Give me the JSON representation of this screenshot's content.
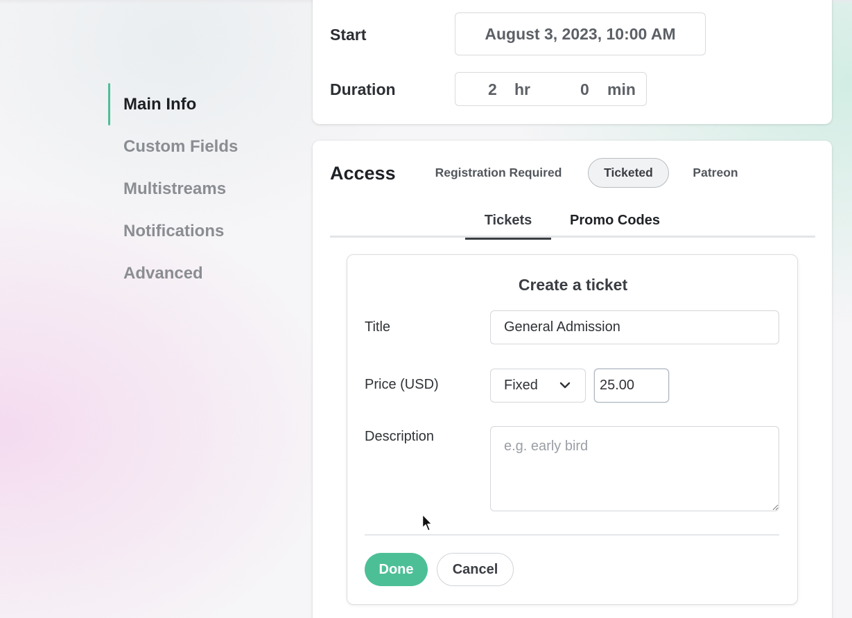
{
  "sidebar": {
    "items": [
      {
        "label": "Main Info",
        "active": true
      },
      {
        "label": "Custom Fields"
      },
      {
        "label": "Multistreams"
      },
      {
        "label": "Notifications"
      },
      {
        "label": "Advanced"
      }
    ]
  },
  "schedule": {
    "start_label": "Start",
    "start_value": "August 3, 2023, 10:00 AM",
    "duration_label": "Duration",
    "duration_hours": "2",
    "hours_unit": "hr",
    "duration_minutes": "0",
    "minutes_unit": "min"
  },
  "access": {
    "title": "Access",
    "options": [
      "Registration Required",
      "Ticketed",
      "Patreon"
    ],
    "selected_option": "Ticketed",
    "tabs": [
      "Tickets",
      "Promo Codes"
    ],
    "active_tab": "Tickets"
  },
  "ticket_form": {
    "heading": "Create a ticket",
    "title_label": "Title",
    "title_value": "General Admission",
    "price_label": "Price (USD)",
    "price_type": "Fixed",
    "price_value": "25.00",
    "description_label": "Description",
    "description_placeholder": "e.g. early bird",
    "done_label": "Done",
    "cancel_label": "Cancel"
  },
  "colors": {
    "accent": "#4dbf97"
  }
}
